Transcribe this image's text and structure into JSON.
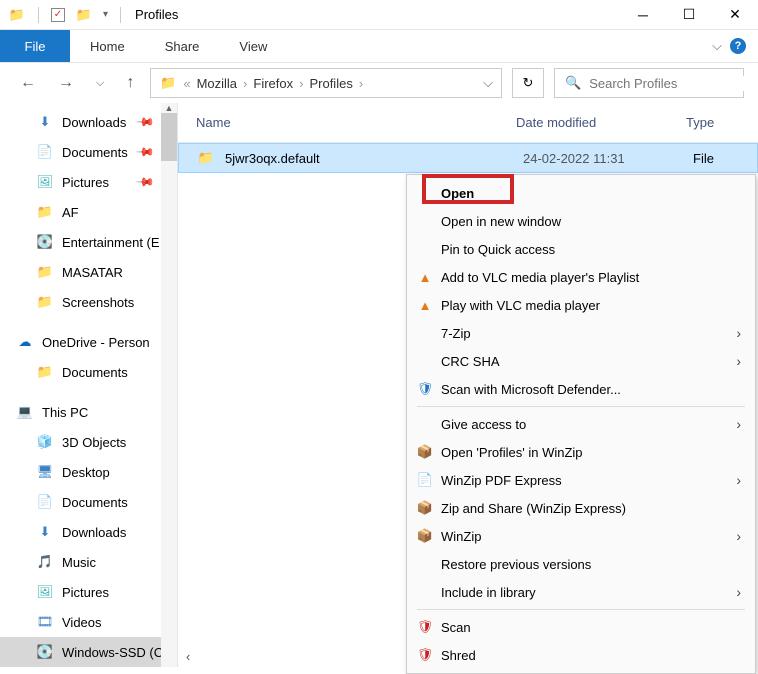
{
  "window": {
    "title": "Profiles"
  },
  "menubar": {
    "file": "File",
    "home": "Home",
    "share": "Share",
    "view": "View"
  },
  "breadcrumb": {
    "items": [
      "Mozilla",
      "Firefox",
      "Profiles"
    ],
    "chevron_left": "«"
  },
  "search": {
    "placeholder": "Search Profiles"
  },
  "columns": {
    "name": "Name",
    "date": "Date modified",
    "type": "Type"
  },
  "sidebar": {
    "quick_access": [
      {
        "label": "Downloads",
        "icon": "download",
        "pinned": true
      },
      {
        "label": "Documents",
        "icon": "doc",
        "pinned": true
      },
      {
        "label": "Pictures",
        "icon": "pic",
        "pinned": true
      },
      {
        "label": "AF",
        "icon": "folder",
        "pinned": false
      },
      {
        "label": "Entertainment (E",
        "icon": "drive",
        "pinned": false
      },
      {
        "label": "MASATAR",
        "icon": "folder",
        "pinned": false
      },
      {
        "label": "Screenshots",
        "icon": "folder",
        "pinned": false
      }
    ],
    "onedrive": {
      "label": "OneDrive - Person",
      "items": [
        {
          "label": "Documents"
        }
      ]
    },
    "thispc": {
      "label": "This PC",
      "items": [
        {
          "label": "3D Objects",
          "icon": "3d"
        },
        {
          "label": "Desktop",
          "icon": "desktop"
        },
        {
          "label": "Documents",
          "icon": "doc"
        },
        {
          "label": "Downloads",
          "icon": "download"
        },
        {
          "label": "Music",
          "icon": "music"
        },
        {
          "label": "Pictures",
          "icon": "pic"
        },
        {
          "label": "Videos",
          "icon": "video"
        },
        {
          "label": "Windows-SSD (C",
          "icon": "drive"
        }
      ]
    }
  },
  "file": {
    "name": "5jwr3oqx.default",
    "date": "24-02-2022 11:31",
    "type": "File"
  },
  "context_menu": {
    "open": "Open",
    "open_new": "Open in new window",
    "pin_quick": "Pin to Quick access",
    "vlc_add": "Add to VLC media player's Playlist",
    "vlc_play": "Play with VLC media player",
    "seven_zip": "7-Zip",
    "crc_sha": "CRC SHA",
    "defender": "Scan with Microsoft Defender...",
    "give_access": "Give access to",
    "open_winzip": "Open 'Profiles' in WinZip",
    "winzip_pdf": "WinZip PDF Express",
    "zip_share": "Zip and Share (WinZip Express)",
    "winzip": "WinZip",
    "restore": "Restore previous versions",
    "include_lib": "Include in library",
    "scan": "Scan",
    "shred": "Shred"
  }
}
